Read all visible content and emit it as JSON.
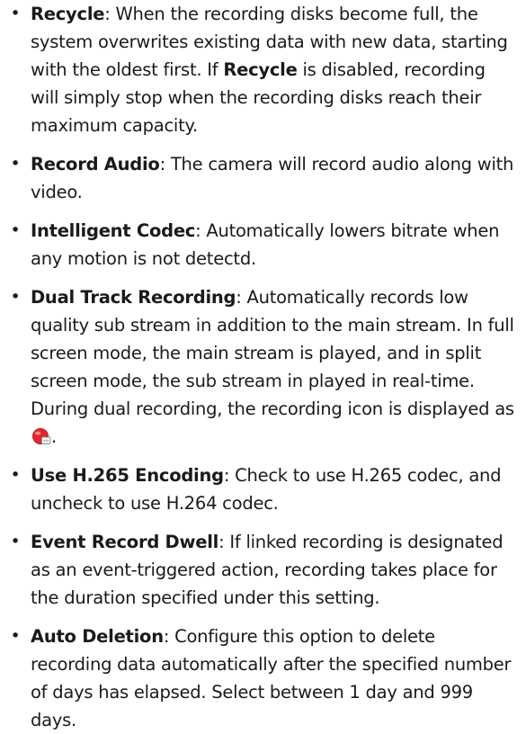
{
  "items": [
    {
      "term": "Recycle",
      "sep": ":",
      "desc_a": " When the recording disks become full, the system overwrites existing data with new data, starting with the oldest first. If ",
      "term_inline": "Recycle",
      "desc_b": " is disabled, recording will simply stop when the recording disks reach their maximum capacity."
    },
    {
      "term": "Record Audio",
      "sep": ":",
      "desc": " The camera will record audio along with video."
    },
    {
      "term": "Intelligent Codec",
      "sep": ":",
      "desc": " Automatically lowers bitrate when any motion is not detectd."
    },
    {
      "term": "Dual Track Recording",
      "sep": ":",
      "desc": " Automatically records low quality sub stream in addition to the main stream. In full screen mode, the main stream is played, and in split screen mode, the sub stream in played in real-time. During dual recording, the recording icon is displayed as ",
      "desc_end": ".",
      "icon": "dual-record-icon",
      "icon_color": "#e3262b"
    },
    {
      "term": "Use H.265 Encoding",
      "sep": ":",
      "desc": " Check to use H.265 codec, and uncheck to use H.264 codec."
    },
    {
      "term": "Event Record Dwell",
      "sep": ":",
      "desc": " If linked recording is designated as an event-triggered action, recording takes place for the duration specified under this setting."
    },
    {
      "term": "Auto Deletion",
      "sep": ":",
      "desc": " Configure this option to delete recording data automatically after the specified number of days has elapsed. Select between 1 day and 999 days."
    }
  ],
  "bullet_char": "•"
}
